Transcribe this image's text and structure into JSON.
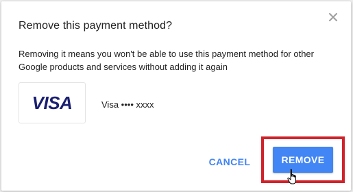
{
  "dialog": {
    "title": "Remove this payment method?",
    "description": "Removing it means you won't be able to use this payment method for other Google products and services without adding it again",
    "close_icon": "close-icon"
  },
  "card": {
    "brand_logo_text": "VISA",
    "label": "Visa •••• xxxx"
  },
  "actions": {
    "cancel_label": "CANCEL",
    "remove_label": "REMOVE"
  },
  "colors": {
    "accent": "#4285f4",
    "highlight": "#d0222a",
    "visa_brand": "#1a1f71"
  },
  "icons": {
    "close": "close-icon",
    "cursor": "hand-pointer-icon"
  }
}
